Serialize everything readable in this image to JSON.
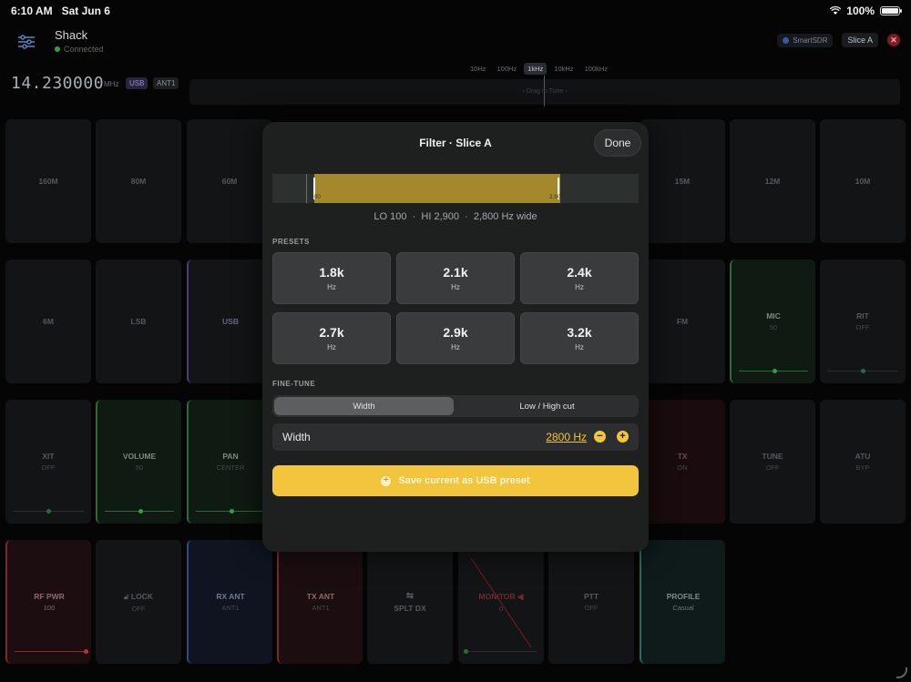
{
  "status": {
    "time": "6:10 AM",
    "date": "Sat Jun 6",
    "battery": "100%"
  },
  "header": {
    "title": "Shack",
    "connection": "Connected",
    "smartsdr": "SmartSDR",
    "slice": "Slice A",
    "close": "✕"
  },
  "frequency": {
    "value": "14.230000",
    "unit": "MHz",
    "mode": "USB",
    "antenna": "ANT1"
  },
  "tune_steps": [
    "10Hz",
    "100Hz",
    "1kHz",
    "10kHz",
    "100kHz"
  ],
  "tune_hint": "‹ Drag to Tune ›",
  "tiles": {
    "r1": [
      "160M",
      "80M",
      "60M",
      "15M",
      "12M",
      "10M"
    ],
    "r2": {
      "t6m": "6M",
      "lsb": "LSB",
      "usb": "USB",
      "fm": "FM",
      "mic": "MIC",
      "mic_val": "50",
      "rit": "RIT",
      "rit_val": "OFF"
    },
    "r3": {
      "xit": "XIT",
      "xit_val": "OFF",
      "volume": "VOLUME",
      "volume_val": "50",
      "pan": "PAN",
      "pan_val": "CENTER",
      "tx": "TX",
      "tx_val": "ON",
      "tune": "TUNE",
      "tune_val": "OFF",
      "atu": "ATU",
      "atu_val": "BYP"
    },
    "r4": {
      "rfpwr": "RF PWR",
      "rfpwr_val": "100",
      "lock": "LOCK",
      "lock_val": "OFF",
      "rxant": "RX ANT",
      "rxant_val": "ANT1",
      "txant": "TX ANT",
      "txant_val": "ANT1",
      "splt": "SPLT DX",
      "monitor": "MONITOR",
      "monitor_val": "0",
      "ptt": "PTT",
      "ptt_val": "OFF",
      "profile": "PROFILE",
      "profile_val": "Casual"
    }
  },
  "sliders": {
    "mic": 0.5,
    "rit": 0.5,
    "xit": 0.5,
    "volume": 0.5,
    "pan": 0.5,
    "rfpwr": 1.0,
    "monitor": 0.0
  },
  "modal": {
    "title": "Filter · Slice A",
    "done": "Done",
    "passband": {
      "lo_hz": 100,
      "hi_hz": 2900,
      "tick_lo": "100",
      "tick_hi": "2,900"
    },
    "summary": "LO 100  ·  HI 2,900  ·  2,800 Hz wide",
    "presets_label": "PRESETS",
    "presets": [
      {
        "value": "1.8k",
        "unit": "Hz"
      },
      {
        "value": "2.1k",
        "unit": "Hz"
      },
      {
        "value": "2.4k",
        "unit": "Hz"
      },
      {
        "value": "2.7k",
        "unit": "Hz"
      },
      {
        "value": "2.9k",
        "unit": "Hz"
      },
      {
        "value": "3.2k",
        "unit": "Hz"
      }
    ],
    "finetune_label": "FINE-TUNE",
    "segment": {
      "width": "Width",
      "lowhigh": "Low / High cut"
    },
    "width_label": "Width",
    "width_value": "2800 Hz",
    "minus": "−",
    "plus": "+",
    "save": "Save current as USB preset"
  },
  "colors": {
    "accent": "#f2c53d",
    "passband": "#a3892c",
    "connected": "#3a9a4a"
  }
}
